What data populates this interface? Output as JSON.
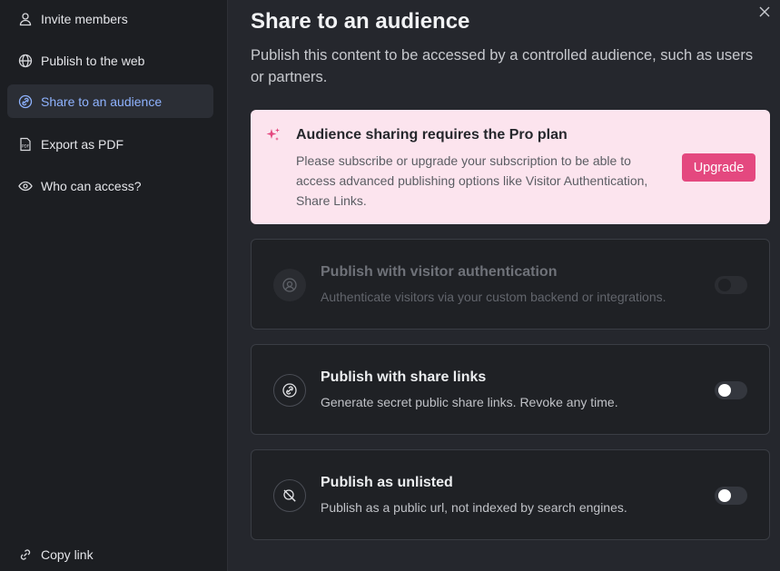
{
  "sidebar": {
    "items": [
      {
        "label": "Invite members",
        "icon": "person-icon"
      },
      {
        "label": "Publish to the web",
        "icon": "globe-icon"
      },
      {
        "label": "Share to an audience",
        "icon": "link-circle-icon",
        "active": true
      },
      {
        "label": "Export as PDF",
        "icon": "pdf-icon"
      },
      {
        "label": "Who can access?",
        "icon": "eye-icon"
      }
    ],
    "copy_link": "Copy link"
  },
  "main": {
    "title": "Share to an audience",
    "description": "Publish this content to be accessed by a controlled audience, such as users or partners.",
    "pro_notice": {
      "title": "Audience sharing requires the Pro plan",
      "text": "Please subscribe or upgrade your subscription to be able to access advanced publishing options like Visitor Authentication, Share Links.",
      "button": "Upgrade"
    },
    "options": [
      {
        "title": "Publish with visitor authentication",
        "text": "Authenticate visitors via your custom backend or integrations.",
        "enabled": false,
        "on": false
      },
      {
        "title": "Publish with share links",
        "text": "Generate secret public share links. Revoke any time.",
        "enabled": true,
        "on": false
      },
      {
        "title": "Publish as unlisted",
        "text": "Publish as a public url, not indexed by search engines.",
        "enabled": true,
        "on": false
      }
    ]
  },
  "colors": {
    "accent": "#e4487f",
    "active_nav_text": "#8fb3ff",
    "notice_bg": "#fce4ee"
  }
}
